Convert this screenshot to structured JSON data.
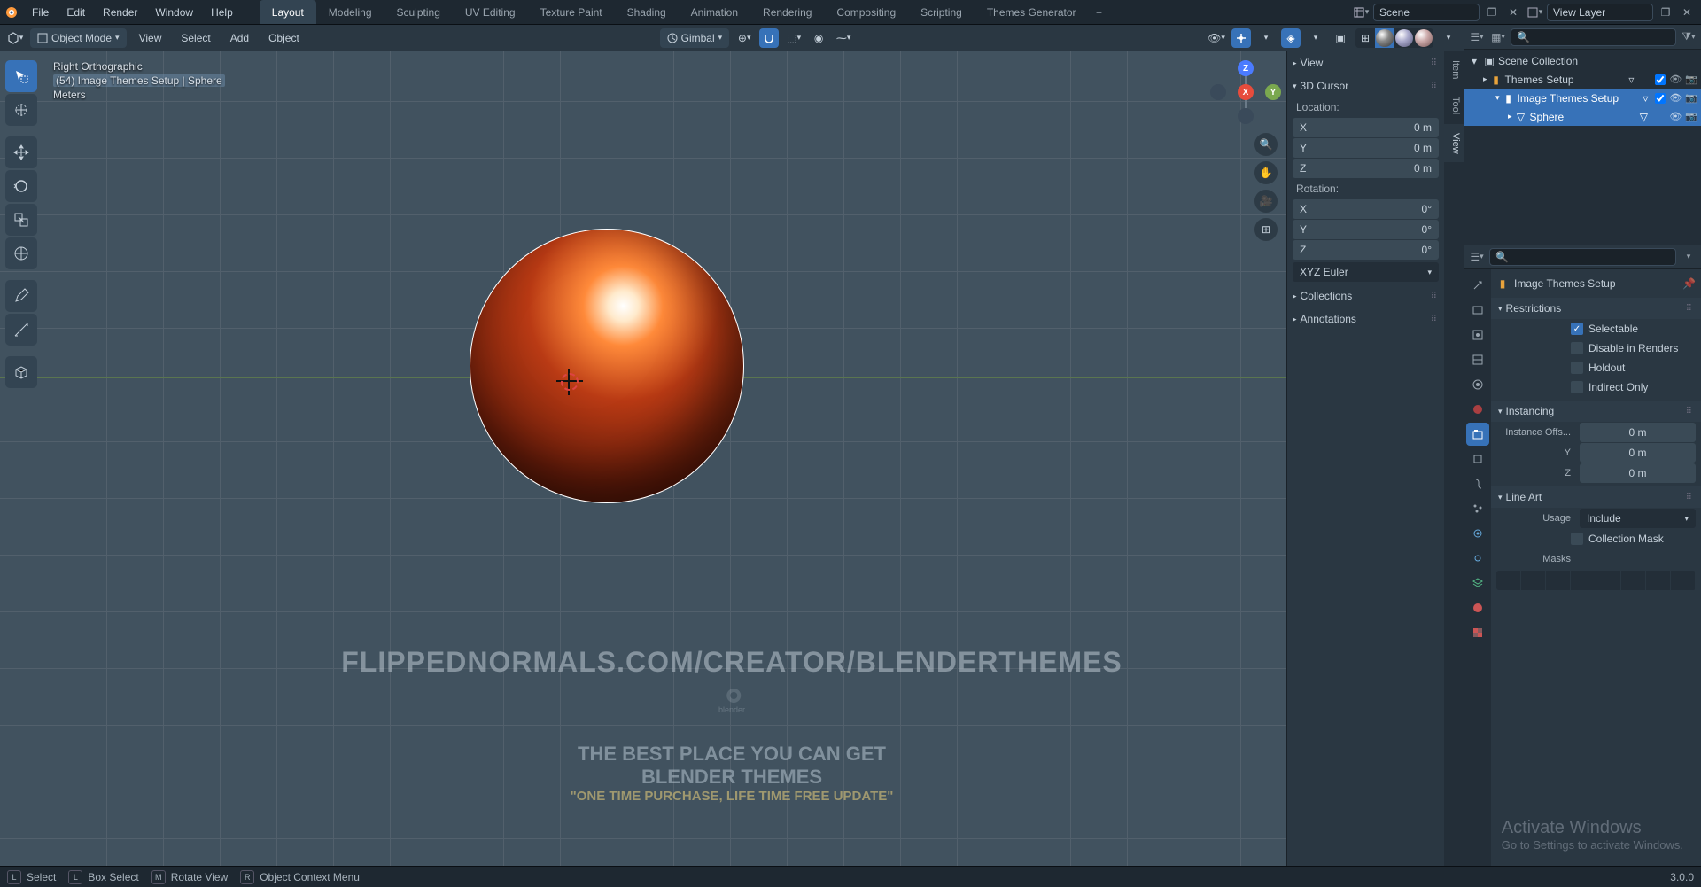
{
  "menus": [
    "File",
    "Edit",
    "Render",
    "Window",
    "Help"
  ],
  "workspaces": [
    "Layout",
    "Modeling",
    "Sculpting",
    "UV Editing",
    "Texture Paint",
    "Shading",
    "Animation",
    "Rendering",
    "Compositing",
    "Scripting",
    "Themes Generator"
  ],
  "active_workspace": "Layout",
  "scene_name": "Scene",
  "viewlayer_name": "View Layer",
  "viewport": {
    "mode": "Object Mode",
    "header_menus": [
      "View",
      "Select",
      "Add",
      "Object"
    ],
    "orientation": "Gimbal",
    "info_line1": "Right Orthographic",
    "info_line2": "(54) Image Themes Setup | Sphere",
    "info_line3": "Meters"
  },
  "npanel": {
    "tabs": [
      "Item",
      "Tool",
      "View"
    ],
    "active_tab": "View",
    "view_label": "View",
    "cursor_label": "3D Cursor",
    "location_label": "Location:",
    "rotation_label": "Rotation:",
    "loc": {
      "x_l": "X",
      "x_v": "0 m",
      "y_l": "Y",
      "y_v": "0 m",
      "z_l": "Z",
      "z_v": "0 m"
    },
    "rot": {
      "x_l": "X",
      "x_v": "0°",
      "y_l": "Y",
      "y_v": "0°",
      "z_l": "Z",
      "z_v": "0°"
    },
    "rot_mode": "XYZ Euler",
    "collections_label": "Collections",
    "annotations_label": "Annotations"
  },
  "outliner": {
    "root": "Scene Collection",
    "items": [
      {
        "name": "Themes Setup",
        "depth": 1,
        "selected": false,
        "type": "collection"
      },
      {
        "name": "Image Themes Setup",
        "depth": 2,
        "selected": true,
        "type": "collection"
      },
      {
        "name": "Sphere",
        "depth": 3,
        "selected": true,
        "type": "mesh"
      }
    ]
  },
  "properties": {
    "breadcrumb": "Image Themes Setup",
    "restrictions": {
      "title": "Restrictions",
      "selectable": "Selectable",
      "disable_render": "Disable in Renders",
      "holdout": "Holdout",
      "indirect": "Indirect Only"
    },
    "instancing": {
      "title": "Instancing",
      "offset_label": "Instance Offs...",
      "x": "0 m",
      "y_l": "Y",
      "y": "0 m",
      "z_l": "Z",
      "z": "0 m"
    },
    "lineart": {
      "title": "Line Art",
      "usage_label": "Usage",
      "usage_value": "Include",
      "mask_label": "Collection Mask",
      "masks_label": "Masks"
    }
  },
  "statusbar": {
    "select": "Select",
    "box": "Box Select",
    "rotate": "Rotate View",
    "context": "Object Context Menu",
    "version": "3.0.0"
  },
  "watermark": {
    "big": "FLIPPEDNORMALS.COM/CREATOR/BLENDERTHEMES",
    "logo_text": "blender",
    "mid1": "THE BEST PLACE YOU CAN GET",
    "mid2": "BLENDER THEMES",
    "sub": "\"ONE TIME PURCHASE, LIFE TIME FREE UPDATE\""
  },
  "activate": {
    "t1": "Activate Windows",
    "t2": "Go to Settings to activate Windows."
  }
}
